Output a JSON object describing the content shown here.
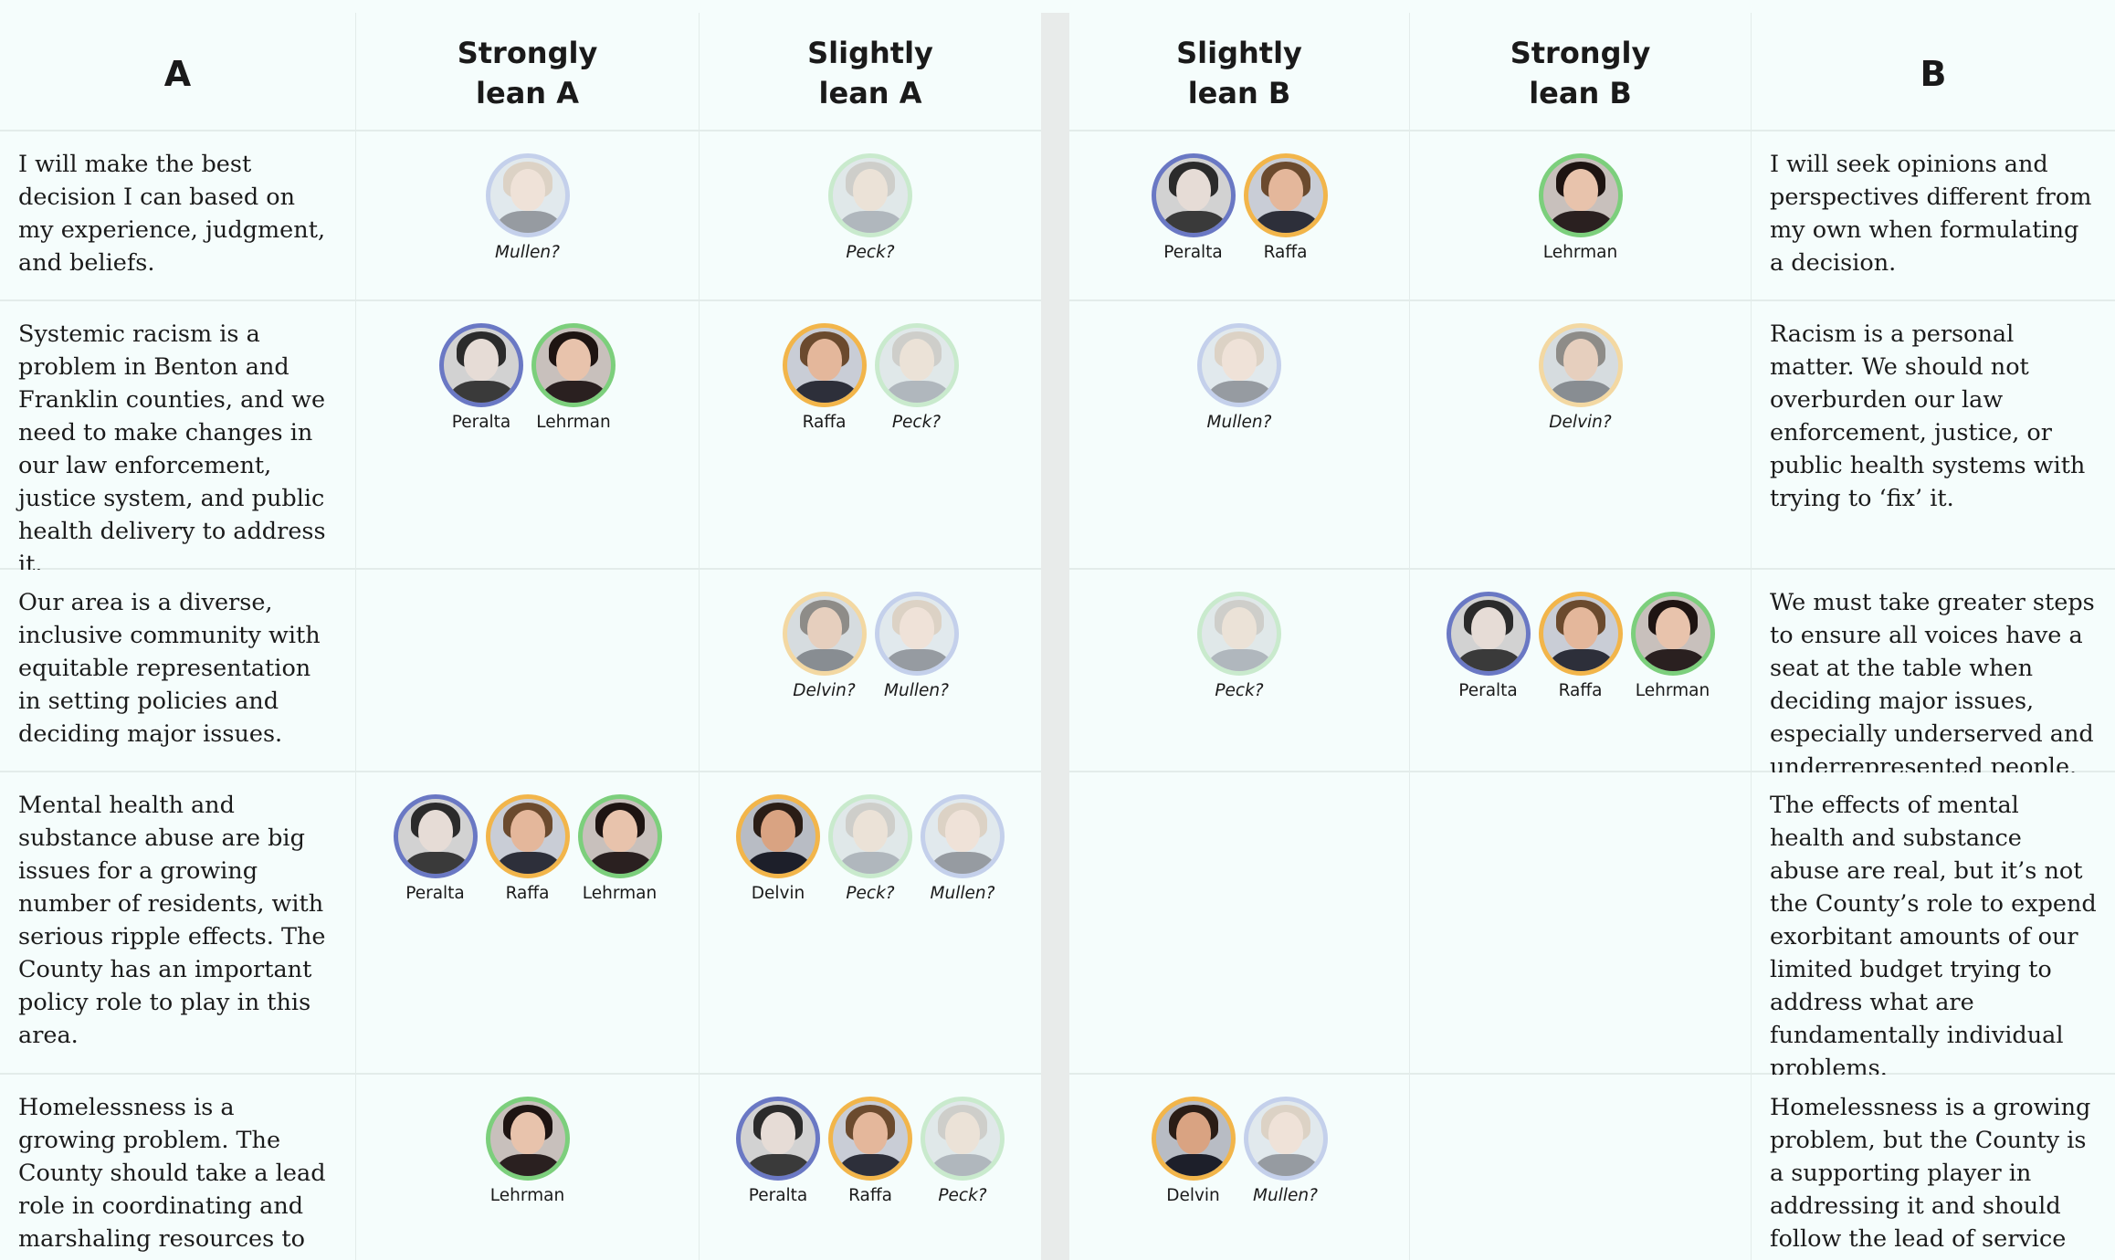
{
  "colors": {
    "peralta": "#6a78c4",
    "raffa": "#f2b54a",
    "lehrman": "#7ccf7c",
    "mullen": "#95a4dc",
    "peck": "#9fd89f",
    "delvin": "#f2b54a"
  },
  "headers": [
    "A",
    "Strongly\nlean A",
    "Slightly\nlean A",
    "Slightly\nlean B",
    "Strongly\nlean B",
    "B"
  ],
  "rows": [
    {
      "a": "I will make the best decision I can based on my experience, judgment, and beliefs.",
      "b": "I will seek opinions and perspectives different from my own when formulating a decision.",
      "cols": [
        [
          {
            "name": "Mullen?",
            "key": "mullen",
            "uncertain": true
          }
        ],
        [
          {
            "name": "Peck?",
            "key": "peck",
            "uncertain": true
          }
        ],
        [
          {
            "name": "Peralta",
            "key": "peralta",
            "uncertain": false
          },
          {
            "name": "Raffa",
            "key": "raffa",
            "uncertain": false
          }
        ],
        [
          {
            "name": "Lehrman",
            "key": "lehrman",
            "uncertain": false
          }
        ]
      ]
    },
    {
      "a": "Systemic racism is a problem in Benton and Franklin counties, and we need to make changes in our law enforcement, justice system, and public health delivery to address it.",
      "b": "Racism is a personal matter. We should not overburden our law enforcement, justice, or public health systems with trying to ‘fix’ it.",
      "cols": [
        [
          {
            "name": "Peralta",
            "key": "peralta",
            "uncertain": false
          },
          {
            "name": "Lehrman",
            "key": "lehrman",
            "uncertain": false
          }
        ],
        [
          {
            "name": "Raffa",
            "key": "raffa",
            "uncertain": false
          },
          {
            "name": "Peck?",
            "key": "peck",
            "uncertain": true
          }
        ],
        [
          {
            "name": "Mullen?",
            "key": "mullen",
            "uncertain": true
          }
        ],
        [
          {
            "name": "Delvin?",
            "key": "delvin",
            "uncertain": true
          }
        ]
      ]
    },
    {
      "a": "Our area is a diverse, inclusive community with equitable representation in setting policies and deciding major issues.",
      "b": "We must take greater steps to ensure all voices have a seat at the table when deciding major issues, especially underserved and underrepresented people.",
      "cols": [
        [],
        [
          {
            "name": "Delvin?",
            "key": "delvin",
            "uncertain": true
          },
          {
            "name": "Mullen?",
            "key": "mullen",
            "uncertain": true
          }
        ],
        [
          {
            "name": "Peck?",
            "key": "peck",
            "uncertain": true
          }
        ],
        [
          {
            "name": "Peralta",
            "key": "peralta",
            "uncertain": false
          },
          {
            "name": "Raffa",
            "key": "raffa",
            "uncertain": false
          },
          {
            "name": "Lehrman",
            "key": "lehrman",
            "uncertain": false
          }
        ]
      ]
    },
    {
      "a": "Mental health and substance abuse are big issues for a growing number of residents, with serious ripple effects. The County has an important policy role to play in this area.",
      "b": "The effects of mental health and substance abuse are real, but it’s not the County’s role to expend exorbitant amounts of our limited budget trying to address what are fundamentally individual problems.",
      "cols": [
        [
          {
            "name": "Peralta",
            "key": "peralta",
            "uncertain": false
          },
          {
            "name": "Raffa",
            "key": "raffa",
            "uncertain": false
          },
          {
            "name": "Lehrman",
            "key": "lehrman",
            "uncertain": false
          }
        ],
        [
          {
            "name": "Delvin",
            "key": "delvin",
            "uncertain": false
          },
          {
            "name": "Peck?",
            "key": "peck",
            "uncertain": true
          },
          {
            "name": "Mullen?",
            "key": "mullen",
            "uncertain": true
          }
        ],
        [],
        []
      ]
    },
    {
      "a": "Homelessness is a growing problem. The County should take a lead role in coordinating and marshaling resources to address it.",
      "b": "Homelessness is a growing problem, but the County is a supporting player in addressing it and should follow the lead of service",
      "cols": [
        [
          {
            "name": "Lehrman",
            "key": "lehrman",
            "uncertain": false
          }
        ],
        [
          {
            "name": "Peralta",
            "key": "peralta",
            "uncertain": false
          },
          {
            "name": "Raffa",
            "key": "raffa",
            "uncertain": false
          },
          {
            "name": "Peck?",
            "key": "peck",
            "uncertain": true
          }
        ],
        [
          {
            "name": "Delvin",
            "key": "delvin",
            "uncertain": false
          },
          {
            "name": "Mullen?",
            "key": "mullen",
            "uncertain": true
          }
        ],
        []
      ]
    }
  ]
}
